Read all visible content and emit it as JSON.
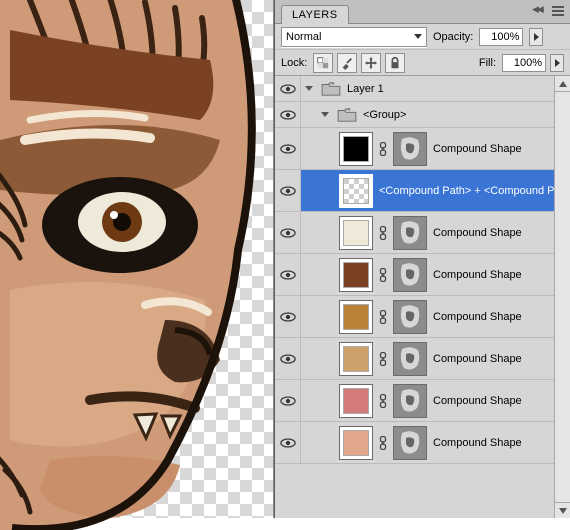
{
  "panel": {
    "title": "LAYERS",
    "blend_mode": "Normal",
    "opacity_label": "Opacity:",
    "opacity_value": "100%",
    "lock_label": "Lock:",
    "fill_label": "Fill:",
    "fill_value": "100%"
  },
  "icons": {
    "eye": "eye-icon",
    "folder": "folder-icon",
    "link": "link-icon",
    "lock_transparency": "lock-transparency-icon",
    "lock_paint": "lock-paint-icon",
    "lock_move": "lock-move-icon",
    "lock_all": "lock-all-icon"
  },
  "layers": {
    "root": {
      "name": "Layer 1"
    },
    "group": {
      "name": "<Group>"
    },
    "items": [
      {
        "name": "Compound Shape",
        "swatch": "#000000",
        "selected": false
      },
      {
        "name": "<Compound Path> + <Compound Pat...",
        "swatch": "checker",
        "selected": true
      },
      {
        "name": "Compound Shape",
        "swatch": "#efe9d9",
        "selected": false
      },
      {
        "name": "Compound Shape",
        "swatch": "#7a4222",
        "selected": false
      },
      {
        "name": "Compound Shape",
        "swatch": "#b98239",
        "selected": false
      },
      {
        "name": "Compound Shape",
        "swatch": "#cda16a",
        "selected": false
      },
      {
        "name": "Compound Shape",
        "swatch": "#d57a7b",
        "selected": false
      },
      {
        "name": "Compound Shape",
        "swatch": "#e2a78a",
        "selected": false
      }
    ]
  },
  "colors": {
    "selection": "#3a75d6",
    "panel_bg": "#d6d6d6"
  }
}
